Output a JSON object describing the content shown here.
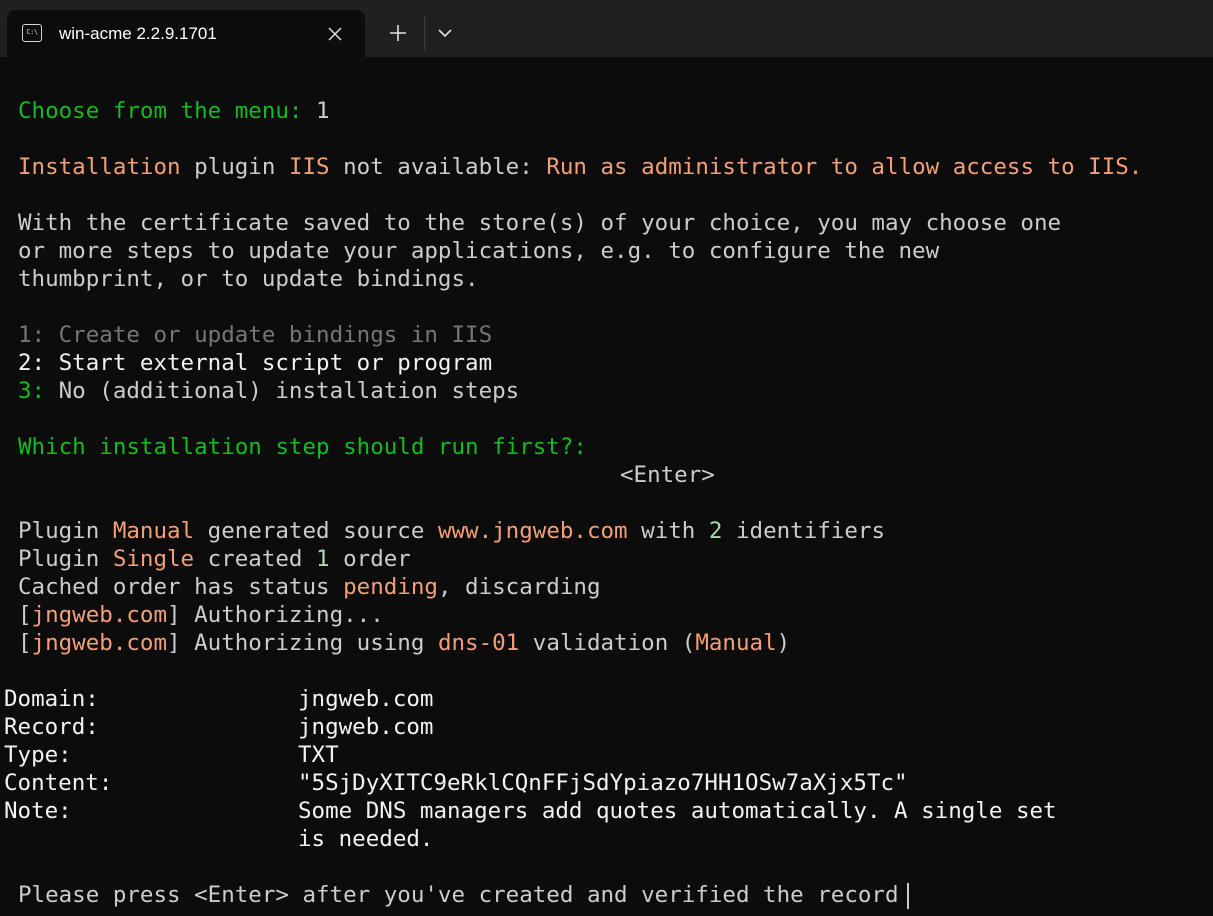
{
  "window": {
    "tab_title": "win-acme 2.2.9.1701",
    "tab_icon_text": "C:\\"
  },
  "icons": {
    "tab_icon": "terminal-icon",
    "close": "close-icon",
    "new_tab": "plus-icon",
    "dropdown": "chevron-down-icon"
  },
  "colors": {
    "background": "#0c0c0c",
    "titlebar": "#202020",
    "green": "#13bb1e",
    "orange": "#f39f79",
    "default_text": "#cccccc",
    "dim": "#767676"
  },
  "terminal": {
    "choose_prompt": "Choose from the menu:",
    "choose_answer": "1",
    "install_warn_1": "Installation",
    "install_warn_2": " plugin ",
    "install_warn_3": "IIS",
    "install_warn_4": " not available: ",
    "install_warn_5": "Run as administrator to allow access to IIS.",
    "desc_1": "With the certificate saved to the store(s) of your choice, you may choose one",
    "desc_2": "or more steps to update your applications, e.g. to configure the new",
    "desc_3": "thumbprint, or to update bindings.",
    "opt1_num": "1:",
    "opt1_text": " Create or update bindings in IIS",
    "opt2_num": "2:",
    "opt2_text": " Start external script or program",
    "opt3_num": "3:",
    "opt3_text": " No (additional) installation steps",
    "which_prompt": "Which installation step should run first?:",
    "enter_text": "<Enter>",
    "plugin1_a": "Plugin ",
    "plugin1_b": "Manual",
    "plugin1_c": " generated source ",
    "plugin1_d": "www.jngweb.com",
    "plugin1_e": " with ",
    "plugin1_f": "2",
    "plugin1_g": " identifiers",
    "plugin2_a": "Plugin ",
    "plugin2_b": "Single",
    "plugin2_c": " created ",
    "plugin2_d": "1",
    "plugin2_e": " order",
    "cached_a": "Cached order has status ",
    "cached_b": "pending",
    "cached_c": ", discarding",
    "auth1_a": "[",
    "auth1_b": "jngweb.com",
    "auth1_c": "] Authorizing...",
    "auth2_a": "[",
    "auth2_b": "jngweb.com",
    "auth2_c": "] Authorizing using ",
    "auth2_d": "dns-01",
    "auth2_e": " validation (",
    "auth2_f": "Manual",
    "auth2_g": ")",
    "record": [
      {
        "label": "Domain:",
        "value": "jngweb.com"
      },
      {
        "label": "Record:",
        "value": "jngweb.com"
      },
      {
        "label": "Type:",
        "value": "TXT"
      },
      {
        "label": "Content:",
        "value": "\"5SjDyXITC9eRklCQnFFjSdYpiazo7HH1OSw7aXjx5Tc\""
      },
      {
        "label": "Note:",
        "value": "Some DNS managers add quotes automatically. A single set"
      },
      {
        "label": "",
        "value": "is needed."
      }
    ],
    "final_prompt": "Please press <Enter> after you've created and verified the record"
  }
}
